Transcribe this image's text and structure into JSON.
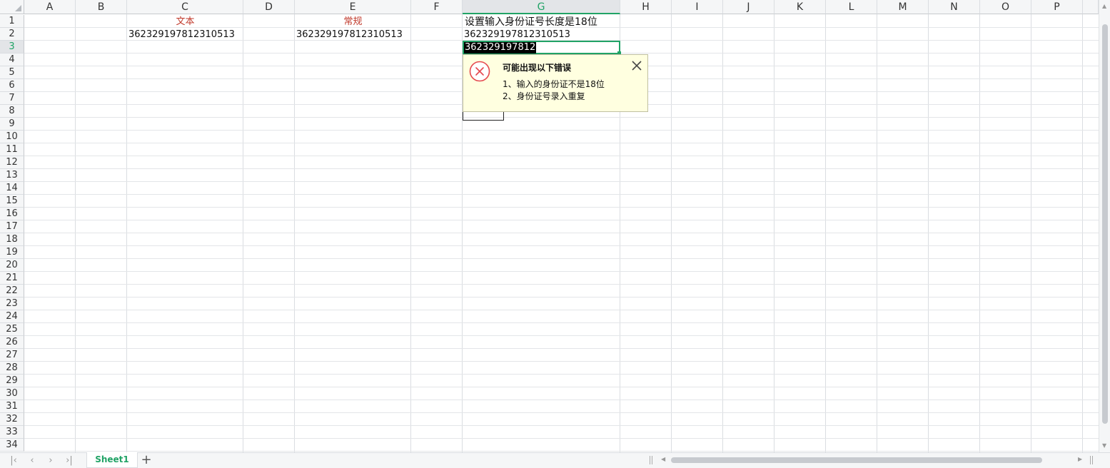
{
  "columns": [
    "A",
    "B",
    "C",
    "D",
    "E",
    "F",
    "G",
    "H",
    "I",
    "J",
    "K",
    "L",
    "M",
    "N",
    "O",
    "P"
  ],
  "selected_column": "G",
  "rows": [
    "1",
    "2",
    "3",
    "4",
    "5",
    "6",
    "7",
    "8",
    "9",
    "10",
    "11",
    "12",
    "13",
    "14",
    "15",
    "16",
    "17",
    "18",
    "19",
    "20",
    "21",
    "22",
    "23",
    "24",
    "25",
    "26",
    "27",
    "28",
    "29",
    "30",
    "31",
    "32",
    "33",
    "34"
  ],
  "selected_row": "3",
  "cells": {
    "C1": "文本",
    "E1": "常规",
    "G1": "设置输入身份证号长度是18位",
    "C2": "362329197812310513",
    "E2": "362329197812310513",
    "G2": "362329197812310513",
    "G3": "362329197812"
  },
  "error_tooltip": {
    "title": "可能出现以下错误",
    "line1": "1、输入的身份证不是18位",
    "line2": "2、身份证号录入重复",
    "icon": "error-x-circle-icon"
  },
  "sheet_tabs": [
    "Sheet1"
  ],
  "colors": {
    "accent": "#21a366",
    "label_red": "#c0392b",
    "tooltip_bg": "#ffffe0"
  }
}
